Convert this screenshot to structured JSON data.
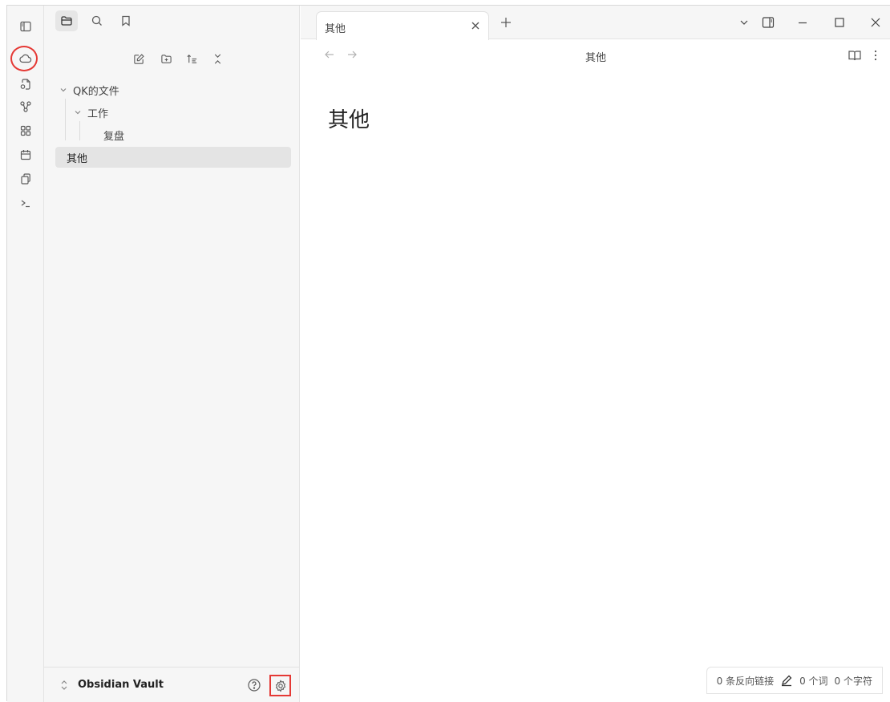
{
  "tab": {
    "title": "其他",
    "new_tab": "+"
  },
  "view_header": {
    "title": "其他"
  },
  "note": {
    "title": "其他"
  },
  "file_tree": {
    "vault_root": "QK的文件",
    "folder": "工作",
    "folder_child": "复盘",
    "file": "其他"
  },
  "vault": {
    "name": "Obsidian Vault"
  },
  "status_bar": {
    "backlinks": "0 条反向链接",
    "words": "0 个词",
    "chars": "0 个字符"
  },
  "icons": {
    "ribbon": [
      "sidebar-toggle-icon",
      "cloud-icon",
      "file-link-icon",
      "graph-icon",
      "grid-icon",
      "calendar-icon",
      "copy-icon",
      "terminal-icon"
    ],
    "sidebar_tabs": [
      "folder-icon",
      "search-icon",
      "bookmark-icon"
    ],
    "nav_actions": [
      "new-note-icon",
      "new-folder-icon",
      "sort-icon",
      "collapse-all-icon"
    ]
  },
  "colors": {
    "highlight": "#e53935",
    "sidebar_bg": "#f6f6f6"
  }
}
